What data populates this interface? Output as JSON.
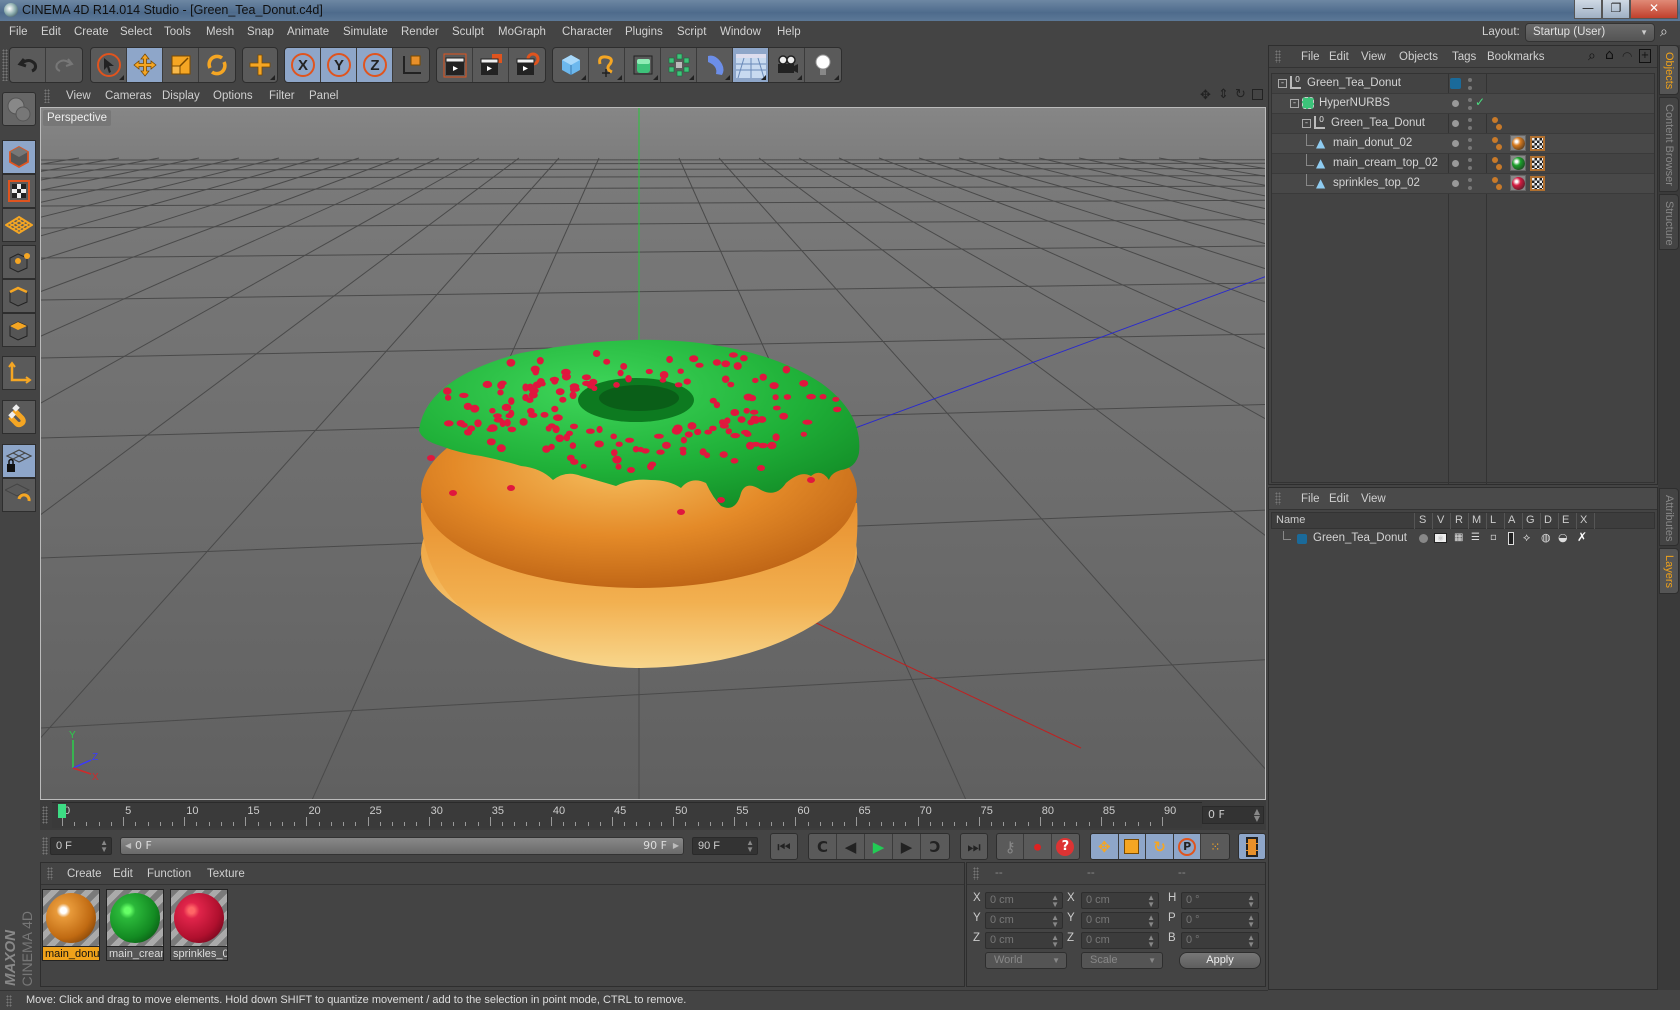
{
  "window": {
    "title": "CINEMA 4D R14.014 Studio - [Green_Tea_Donut.c4d]",
    "minimize_label": "—",
    "maximize_label": "❐",
    "close_label": "✕"
  },
  "menubar": {
    "items": [
      "File",
      "Edit",
      "Create",
      "Select",
      "Tools",
      "Mesh",
      "Snap",
      "Animate",
      "Simulate",
      "Render",
      "Sculpt",
      "MoGraph",
      "Character",
      "Plugins",
      "Script",
      "Window",
      "Help"
    ],
    "layout_label": "Layout:",
    "layout_value": "Startup (User)"
  },
  "toolbar": {
    "groups": [
      [
        "undo-icon",
        "redo-icon"
      ],
      [
        "live-selection-icon",
        "move-icon",
        "scale-icon",
        "rotate-icon"
      ],
      [
        "last-tool-icon"
      ],
      [
        "x-axis-lock-icon",
        "y-axis-lock-icon",
        "z-axis-lock-icon",
        "coordinate-system-icon"
      ],
      [
        "render-view-icon",
        "render-picture-viewer-icon",
        "render-settings-icon"
      ],
      [
        "cube-icon",
        "spline-pen-icon",
        "subdivision-surface-icon",
        "mograph-cloner-icon",
        "deformer-bend-icon",
        "floor-icon",
        "camera-icon",
        "light-icon"
      ]
    ]
  },
  "left_toolbar": {
    "items": [
      "make-editable-icon",
      "model-mode-icon",
      "texture-mode-icon",
      "workplane-mode-icon",
      "points-mode-icon",
      "edges-mode-icon",
      "polygons-mode-icon",
      "axis-mode-icon",
      "snap-magnet-icon",
      "lock-workplane-icon",
      "workplane-align-icon"
    ]
  },
  "viewport": {
    "menu": [
      "View",
      "Cameras",
      "Display",
      "Options",
      "Filter",
      "Panel"
    ],
    "camera_label": "Perspective",
    "nav_icons": [
      "pan-icon",
      "dolly-icon",
      "rotate-view-icon",
      "toggle-layout-icon"
    ],
    "axis_labels": {
      "x": "X",
      "y": "Y",
      "z": "Z"
    },
    "colors": {
      "glaze": "#1fb038",
      "sprinkle": "#e0173e",
      "dough": "#e48a28",
      "background": "#6b6b6b"
    }
  },
  "timeline": {
    "ticks": [
      "0",
      "5",
      "10",
      "15",
      "20",
      "25",
      "30",
      "35",
      "40",
      "45",
      "50",
      "55",
      "60",
      "65",
      "70",
      "75",
      "80",
      "85",
      "90"
    ],
    "current_frame": "0 F",
    "start_field": "0 F",
    "range_start": "0 F",
    "range_end": "90 F",
    "end_field": "90 F",
    "playhead_color": "#3ddc84"
  },
  "material_manager": {
    "menu": [
      "Create",
      "Edit",
      "Function",
      "Texture"
    ],
    "materials": [
      {
        "label": "main_donu",
        "color": "#d77a1e",
        "selected": true
      },
      {
        "label": "main_crean",
        "color": "#1aa02a",
        "selected": false
      },
      {
        "label": "sprinkles_0",
        "color": "#d41a40",
        "selected": false
      }
    ],
    "brand_top": "MAXON",
    "brand_bottom": "CINEMA 4D"
  },
  "coord_manager": {
    "headers": [
      "--",
      "--",
      "--"
    ],
    "rows": [
      {
        "l1": "X",
        "v1": "0 cm",
        "l2": "X",
        "v2": "0 cm",
        "l3": "H",
        "v3": "0 °"
      },
      {
        "l1": "Y",
        "v1": "0 cm",
        "l2": "Y",
        "v2": "0 cm",
        "l3": "P",
        "v3": "0 °"
      },
      {
        "l1": "Z",
        "v1": "0 cm",
        "l2": "Z",
        "v2": "0 cm",
        "l3": "B",
        "v3": "0 °"
      }
    ],
    "space_select": "World",
    "mode_select": "Scale",
    "apply_label": "Apply"
  },
  "status_bar": {
    "text": "Move: Click and drag to move elements. Hold down SHIFT to quantize movement / add to the selection in point mode, CTRL to remove."
  },
  "object_manager": {
    "menu": [
      "File",
      "Edit",
      "View",
      "Objects",
      "Tags",
      "Bookmarks"
    ],
    "objects": [
      {
        "name": "Green_Tea_Donut",
        "indent": 0,
        "type": "null",
        "tags": []
      },
      {
        "name": "HyperNURBS",
        "indent": 1,
        "type": "hypernurbs",
        "tags": [
          "check"
        ]
      },
      {
        "name": "Green_Tea_Donut",
        "indent": 2,
        "type": "null",
        "tags": [
          "phong"
        ]
      },
      {
        "name": "main_donut_02",
        "indent": 3,
        "type": "polygon",
        "tags": [
          "phong",
          "material:#d77a1e",
          "texture"
        ]
      },
      {
        "name": "main_cream_top_02",
        "indent": 3,
        "type": "polygon",
        "tags": [
          "phong",
          "material:#1aa02a",
          "texture"
        ]
      },
      {
        "name": "sprinkles_top_02",
        "indent": 3,
        "type": "polygon",
        "tags": [
          "phong",
          "material:#d41a40",
          "texture"
        ]
      }
    ]
  },
  "layer_manager": {
    "menu": [
      "File",
      "Edit",
      "View"
    ],
    "columns": [
      "Name",
      "S",
      "V",
      "R",
      "M",
      "L",
      "A",
      "G",
      "D",
      "E",
      "X"
    ],
    "layers": [
      {
        "name": "Green_Tea_Donut",
        "color": "#1a6a9a"
      }
    ]
  },
  "side_tabs": {
    "top": [
      {
        "label": "Objects",
        "active": true
      },
      {
        "label": "Content Browser",
        "active": false
      },
      {
        "label": "Structure",
        "active": false
      }
    ],
    "bottom": [
      {
        "label": "Attributes",
        "active": false
      },
      {
        "label": "Layers",
        "active": true
      }
    ]
  }
}
